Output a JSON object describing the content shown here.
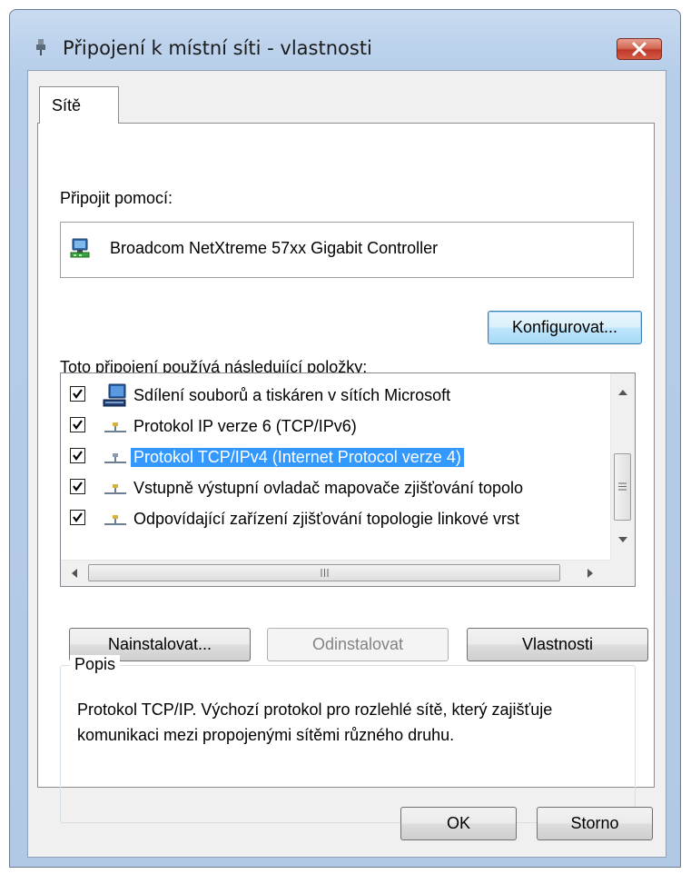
{
  "window": {
    "title": "Připojení k místní síti - vlastnosti"
  },
  "tabs": [
    {
      "label": "Sítě"
    }
  ],
  "connect_using": {
    "label": "Připojit pomocí:",
    "adapter_name": "Broadcom NetXtreme 57xx Gigabit Controller",
    "configure_button": "Konfigurovat..."
  },
  "items_section": {
    "label": "Toto připojení používá následující položky:",
    "items": [
      {
        "label": "Sdílení souborů a tiskáren v sítích Microsoft",
        "checked": true,
        "icon": "computer-icon",
        "selected": false
      },
      {
        "label": "Protokol IP verze 6 (TCP/IPv6)",
        "checked": true,
        "icon": "network-protocol-icon",
        "selected": false
      },
      {
        "label": "Protokol TCP/IPv4 (Internet Protocol verze 4)",
        "checked": true,
        "icon": "network-protocol-icon",
        "selected": true
      },
      {
        "label": "Vstupně výstupní ovladač mapovače zjišťování topolo",
        "checked": true,
        "icon": "network-protocol-icon",
        "selected": false
      },
      {
        "label": "Odpovídající zařízení zjišťování topologie linkové vrst",
        "checked": true,
        "icon": "network-protocol-icon",
        "selected": false
      }
    ]
  },
  "action_buttons": {
    "install": "Nainstalovat...",
    "uninstall": "Odinstalovat",
    "properties": "Vlastnosti"
  },
  "description": {
    "title": "Popis",
    "text": "Protokol TCP/IP. Výchozí protokol pro rozlehlé sítě, který zajišťuje komunikaci mezi propojenými sítěmi různého druhu."
  },
  "footer": {
    "ok": "OK",
    "cancel": "Storno"
  },
  "colors": {
    "selection": "#3399ff",
    "close_button": "#c0392b",
    "titlebar": "#bcd2ec"
  }
}
